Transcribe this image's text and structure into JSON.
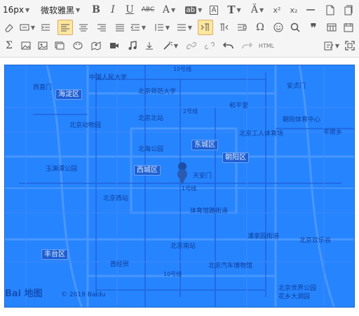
{
  "toolbar": {
    "font_size": "16px",
    "font_family": "微软雅黑",
    "bold": "B",
    "italic": "I",
    "underline": "U",
    "strike": "ABC",
    "font_color": "A",
    "highlight": "ab",
    "text_box": "A",
    "title_t": "T",
    "superscript": "x²",
    "subscript": "x₂",
    "quote": "❞",
    "omega": "Ω",
    "sigma": "Σ",
    "html": "HTML"
  },
  "map": {
    "labels": [
      "10号线",
      "中国人民大学",
      "北京师范大学",
      "西直门",
      "海淀区",
      "北京动物园",
      "北京北站",
      "2号线",
      "北海公园",
      "东城区",
      "朝阳区",
      "玉渊潭公园",
      "西城区",
      "天安门",
      "1号线",
      "北京西站",
      "体育馆路街道",
      "潘家园街道",
      "北京南站",
      "丰台区",
      "北京欢乐谷",
      "首经贸",
      "10号线",
      "北京汽车博物馆",
      "北京世界公园",
      "花乡大洞园",
      "北京工人体育场",
      "朝阳体育中心",
      "安贞门",
      "和平里",
      "平房乡"
    ],
    "logo": "Bai 地图",
    "copyright": "© 2019 Baidu"
  },
  "colors": {
    "map_overlay": "#2784ff",
    "active_button": "#ffe69f"
  }
}
